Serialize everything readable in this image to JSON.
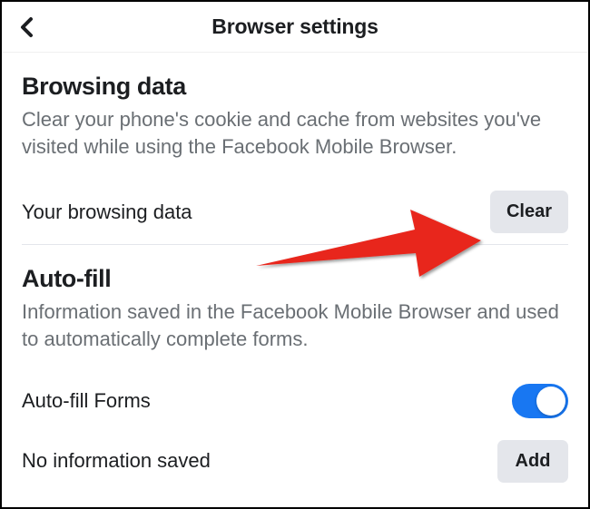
{
  "header": {
    "title": "Browser settings"
  },
  "browsing_data": {
    "title": "Browsing data",
    "description": "Clear your phone's cookie and cache from websites you've visited while using the Facebook Mobile Browser.",
    "row_label": "Your browsing data",
    "clear_label": "Clear"
  },
  "auto_fill": {
    "title": "Auto-fill",
    "description": "Information saved in the Facebook Mobile Browser and used to automatically complete forms.",
    "forms_label": "Auto-fill Forms",
    "forms_toggle": true,
    "no_info_label": "No information saved",
    "add_label": "Add"
  }
}
